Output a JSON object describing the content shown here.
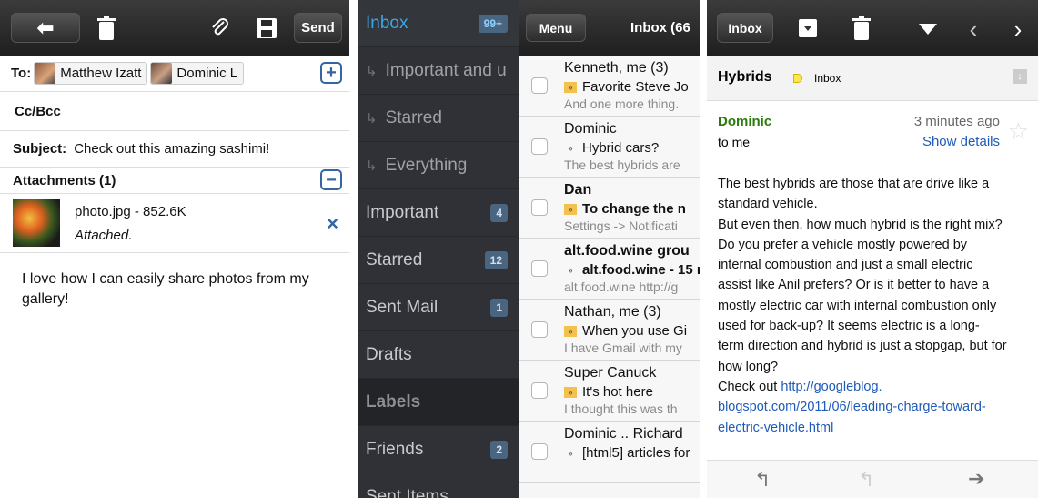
{
  "compose": {
    "send_label": "Send",
    "to_label": "To:",
    "recipients": [
      "Matthew Izatt",
      "Dominic L"
    ],
    "ccbcc_label": "Cc/Bcc",
    "subject_label": "Subject:",
    "subject_value": "Check out this amazing sashimi!",
    "attachments_label": "Attachments (1)",
    "attachment": {
      "name": "photo.jpg - 852.6K",
      "status": "Attached."
    },
    "body": "I love how I can easily share photos from my gallery!",
    "plus_symbol": "+",
    "minus_symbol": "−",
    "remove_symbol": "×"
  },
  "drawer": {
    "items": [
      {
        "label": "Inbox",
        "count": "99+",
        "active": true
      },
      {
        "label": "Important and u",
        "sub": true
      },
      {
        "label": "Starred",
        "sub": true
      },
      {
        "label": "Everything",
        "sub": true
      },
      {
        "label": "Important",
        "count": "4"
      },
      {
        "label": "Starred",
        "count": "12"
      },
      {
        "label": "Sent Mail",
        "count": "1"
      },
      {
        "label": "Drafts"
      },
      {
        "label": "Labels",
        "header": true
      },
      {
        "label": "Friends",
        "count": "2"
      },
      {
        "label": "Sent Items"
      }
    ],
    "sub_arrow": "↳"
  },
  "inbox": {
    "menu_label": "Menu",
    "title": "Inbox (66",
    "messages": [
      {
        "from": "Kenneth, me (3)",
        "subject": "Favorite Steve Jo",
        "snippet": "And one more thing.",
        "important": true,
        "unread": false
      },
      {
        "from": "Dominic",
        "subject": "Hybrid cars?",
        "snippet": "The best hybrids are",
        "important": false,
        "unread": false
      },
      {
        "from": "Dan",
        "subject": "To change the n",
        "snippet": "Settings -> Notificati",
        "important": true,
        "unread": true
      },
      {
        "from": "alt.food.wine grou",
        "subject": "alt.food.wine - 15 n",
        "snippet": "alt.food.wine http://g",
        "important": false,
        "unread": true
      },
      {
        "from": "Nathan, me (3)",
        "subject": "When you use Gi",
        "snippet": "I have Gmail with my",
        "important": true,
        "unread": false
      },
      {
        "from": "Super Canuck",
        "subject": "It's hot here",
        "snippet": "I thought this was th",
        "important": true,
        "unread": false
      },
      {
        "from": "Dominic .. Richard",
        "subject": "[html5] articles for",
        "snippet": "",
        "important": false,
        "unread": false
      }
    ]
  },
  "thread": {
    "back_label": "Inbox",
    "subject": "Hybrids",
    "label_chip": "Inbox",
    "sender": "Dominic",
    "recipient": "to me",
    "time": "3 minutes ago",
    "show_details": "Show details",
    "body_lines": [
      "The best hybrids are those that are drive like a",
      "standard vehicle.",
      "But even then, how much hybrid is the right mix?",
      "Do you prefer a vehicle mostly powered by",
      "internal combustion and just a small electric",
      "assist like Anil prefers? Or is it better to have a",
      "mostly electric car with internal combustion only",
      "used for back-up? It seems electric is a long-",
      "term direction and hybrid is just a stopgap, but for",
      "how long?"
    ],
    "checkout_label": "Check out",
    "link_lines": [
      "http://googleblog.",
      "blogspot.com/2011/06/leading-charge-toward-",
      "electric-vehicle.html"
    ]
  },
  "colors": {
    "accent": "#3465a4",
    "drawer_bg": "#2f3136",
    "active_blue": "#39a7e6",
    "sender_green": "#2b7a0b"
  }
}
